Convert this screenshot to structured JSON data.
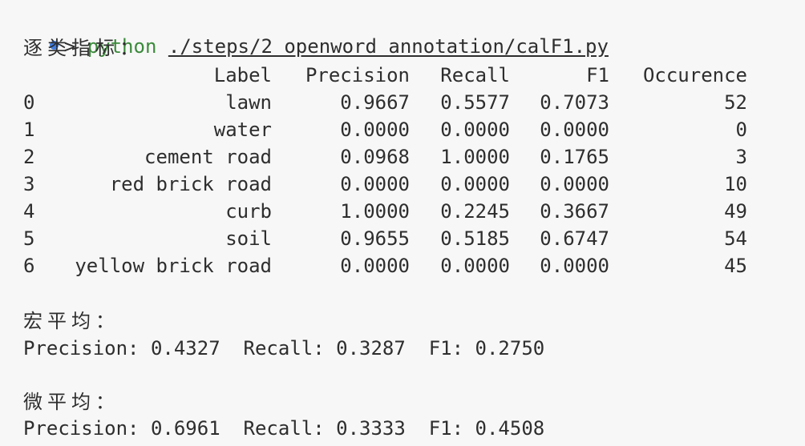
{
  "terminal": {
    "accent_dot_color": "#3d7be0",
    "prompt_caret": ">",
    "command": "python",
    "command_arg": "./steps/2 openword annotation/calF1.py"
  },
  "output": {
    "per_class_heading": "逐类指标：",
    "table": {
      "headers": [
        "Label",
        "Precision",
        "Recall",
        "F1",
        "Occurence"
      ],
      "rows": [
        {
          "index": "0",
          "label": "lawn",
          "precision": "0.9667",
          "recall": "0.5577",
          "f1": "0.7073",
          "occurence": "52"
        },
        {
          "index": "1",
          "label": "water",
          "precision": "0.0000",
          "recall": "0.0000",
          "f1": "0.0000",
          "occurence": "0"
        },
        {
          "index": "2",
          "label": "cement road",
          "precision": "0.0968",
          "recall": "1.0000",
          "f1": "0.1765",
          "occurence": "3"
        },
        {
          "index": "3",
          "label": "red brick road",
          "precision": "0.0000",
          "recall": "0.0000",
          "f1": "0.0000",
          "occurence": "10"
        },
        {
          "index": "4",
          "label": "curb",
          "precision": "1.0000",
          "recall": "0.2245",
          "f1": "0.3667",
          "occurence": "49"
        },
        {
          "index": "5",
          "label": "soil",
          "precision": "0.9655",
          "recall": "0.5185",
          "f1": "0.6747",
          "occurence": "54"
        },
        {
          "index": "6",
          "label": "yellow brick road",
          "precision": "0.0000",
          "recall": "0.0000",
          "f1": "0.0000",
          "occurence": "45"
        }
      ]
    },
    "macro_heading": "宏平均：",
    "macro_line": "Precision: 0.4327  Recall: 0.3287  F1: 0.2750",
    "micro_heading": "微平均：",
    "micro_line": "Precision: 0.6961  Recall: 0.3333  F1: 0.4508"
  }
}
